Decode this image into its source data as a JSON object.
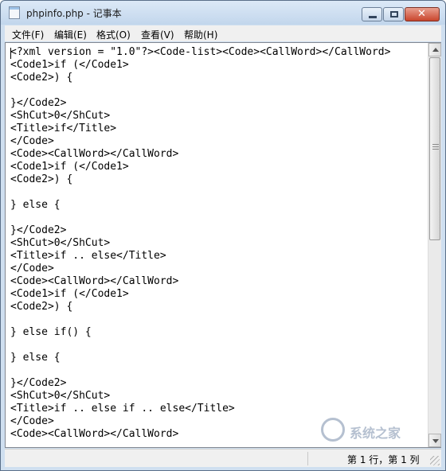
{
  "window": {
    "title": "phpinfo.php - 记事本"
  },
  "menu": [
    {
      "label": "文件(F)"
    },
    {
      "label": "编辑(E)"
    },
    {
      "label": "格式(O)"
    },
    {
      "label": "查看(V)"
    },
    {
      "label": "帮助(H)"
    }
  ],
  "editor": {
    "lines": [
      "<?xml version = \"1.0\"?><Code-list><Code><CallWord></CallWord>",
      "<Code1>if (</Code1>",
      "<Code2>) {",
      "",
      "}</Code2>",
      "<ShCut>0</ShCut>",
      "<Title>if</Title>",
      "</Code>",
      "<Code><CallWord></CallWord>",
      "<Code1>if (</Code1>",
      "<Code2>) {",
      "",
      "} else {",
      "",
      "}</Code2>",
      "<ShCut>0</ShCut>",
      "<Title>if .. else</Title>",
      "</Code>",
      "<Code><CallWord></CallWord>",
      "<Code1>if (</Code1>",
      "<Code2>) {",
      "",
      "} else if() {",
      "",
      "} else {",
      "",
      "}</Code2>",
      "<ShCut>0</ShCut>",
      "<Title>if .. else if .. else</Title>",
      "</Code>",
      "<Code><CallWord></CallWord>"
    ]
  },
  "statusbar": {
    "position": "第 1 行，第 1 列"
  },
  "icons": {
    "app": "notepad-icon",
    "minimize": "minimize-icon",
    "maximize": "maximize-icon",
    "close": "close-icon"
  },
  "watermark": {
    "text": "系统之家"
  },
  "colors": {
    "titlebar": "#c8dbef",
    "close_button": "#c9452d"
  }
}
